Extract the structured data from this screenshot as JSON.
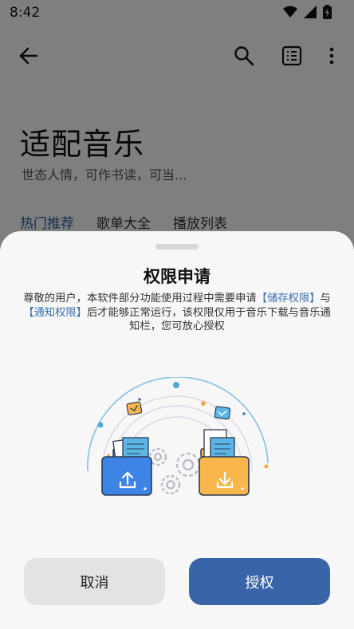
{
  "status": {
    "time": "8:42"
  },
  "app": {
    "title": "适配音乐",
    "subtitle": "世态人情，可作书读，可当...",
    "tabs": [
      "热门推荐",
      "歌单大全",
      "播放列表"
    ]
  },
  "dialog": {
    "title": "权限申请",
    "body": {
      "p1": "尊敬的用户，本软件部分功能使用过程中需要申请",
      "storage": "【储存权限】",
      "p2": "与",
      "notify": "【通知权限】",
      "p3": "后才能够正常运行，该权限仅用于音乐下载与音乐通知栏，您可放心授权"
    },
    "cancel_label": "取消",
    "grant_label": "授权"
  },
  "colors": {
    "accent": "#3a64a8",
    "link": "#3a6fb0"
  }
}
